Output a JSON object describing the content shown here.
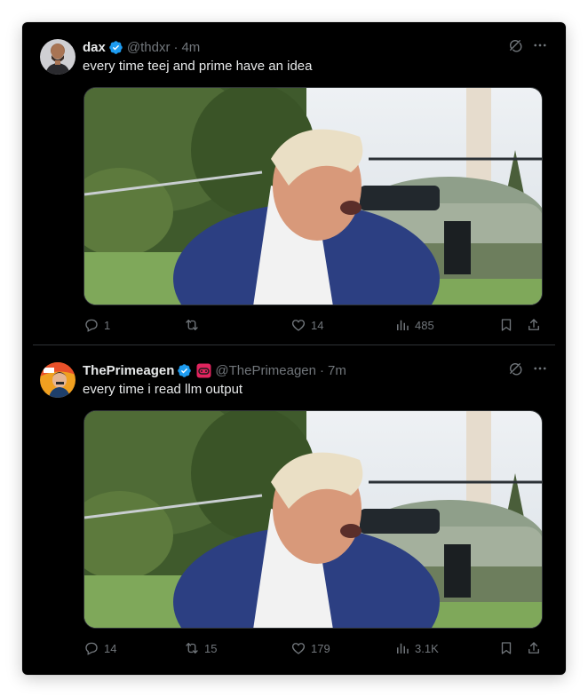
{
  "colors": {
    "background": "#000000",
    "text": "#e7e9ea",
    "muted": "#71767b",
    "verified": "#1d9bf0",
    "divider": "#2f3336"
  },
  "tweets": [
    {
      "author": {
        "name": "dax",
        "handle": "@thdxr",
        "verified": true
      },
      "time": "4m",
      "text": "every time teej and prime have an idea",
      "media": {
        "type": "image",
        "icon": "photo"
      },
      "stats": {
        "replies": "1",
        "retweets": "",
        "likes": "14",
        "views": "485"
      }
    },
    {
      "author": {
        "name": "ThePrimeagen",
        "handle": "@ThePrimeagen",
        "verified": true,
        "affiliate_badge": true
      },
      "time": "7m",
      "text": "every time i read llm output",
      "media": {
        "type": "image",
        "icon": "photo"
      },
      "stats": {
        "replies": "14",
        "retweets": "15",
        "likes": "179",
        "views": "3.1K"
      }
    }
  ],
  "ui": {
    "separator": "·",
    "icons": [
      "grok-icon",
      "more-icon",
      "reply-icon",
      "retweet-icon",
      "like-icon",
      "views-icon",
      "bookmark-icon",
      "share-icon"
    ]
  }
}
